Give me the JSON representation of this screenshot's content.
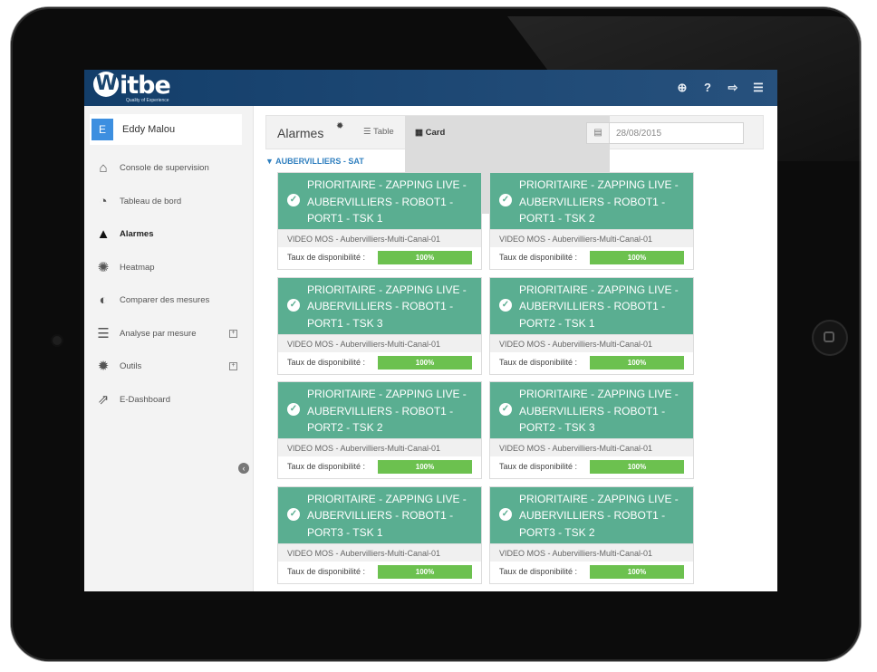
{
  "app": {
    "logo_text": "itbe",
    "logo_mark": "W",
    "logo_tagline": "Quality of Experience"
  },
  "header_icons": [
    {
      "name": "globe-icon",
      "glyph": "⊕"
    },
    {
      "name": "help-icon",
      "glyph": "?"
    },
    {
      "name": "logout-icon",
      "glyph": "⇨"
    },
    {
      "name": "menu-icon",
      "glyph": "☰"
    }
  ],
  "user": {
    "initial": "E",
    "name": "Eddy Malou"
  },
  "sidebar": {
    "items": [
      {
        "label": "Console de supervision",
        "icon": "home-icon",
        "glyph": "⌂",
        "active": false,
        "expandable": false
      },
      {
        "label": "Tableau de bord",
        "icon": "dashboard-icon",
        "glyph": "◔",
        "active": false,
        "expandable": false
      },
      {
        "label": "Alarmes",
        "icon": "warning-icon",
        "glyph": "▲",
        "active": true,
        "expandable": false
      },
      {
        "label": "Heatmap",
        "icon": "spinner-icon",
        "glyph": "✺",
        "active": false,
        "expandable": false
      },
      {
        "label": "Comparer des mesures",
        "icon": "contrast-icon",
        "glyph": "◐",
        "active": false,
        "expandable": false
      },
      {
        "label": "Analyse par mesure",
        "icon": "list-icon",
        "glyph": "☰",
        "active": false,
        "expandable": true
      },
      {
        "label": "Outils",
        "icon": "gear-icon",
        "glyph": "✹",
        "active": false,
        "expandable": true
      },
      {
        "label": "E-Dashboard",
        "icon": "external-link-icon",
        "glyph": "⇗",
        "active": false,
        "expandable": false
      }
    ]
  },
  "toolbar": {
    "title": "Alarmes",
    "table_label": "Table",
    "card_label": "Card",
    "date_value": "28/08/2015"
  },
  "group": {
    "title": "▼ AUBERVILLIERS - SAT"
  },
  "cards": [
    {
      "title": "PRIORITAIRE - ZAPPING LIVE - AUBERVILLIERS - ROBOT1 - PORT1 - TSK 1",
      "subtitle": "VIDEO MOS - Aubervilliers-Multi-Canal-01",
      "avail_label": "Taux de disponibilité :",
      "avail_value": "100%",
      "avail_fraction": 1.0
    },
    {
      "title": "PRIORITAIRE - ZAPPING LIVE - AUBERVILLIERS - ROBOT1 - PORT1 - TSK 2",
      "subtitle": "VIDEO MOS - Aubervilliers-Multi-Canal-01",
      "avail_label": "Taux de disponibilité :",
      "avail_value": "100%",
      "avail_fraction": 1.0
    },
    {
      "title": "PRIORITAIRE - ZAPPING LIVE - AUBERVILLIERS - ROBOT1 - PORT1 - TSK 3",
      "subtitle": "VIDEO MOS - Aubervilliers-Multi-Canal-01",
      "avail_label": "Taux de disponibilité :",
      "avail_value": "100%",
      "avail_fraction": 1.0
    },
    {
      "title": "PRIORITAIRE - ZAPPING LIVE - AUBERVILLIERS - ROBOT1 - PORT2 - TSK 1",
      "subtitle": "VIDEO MOS - Aubervilliers-Multi-Canal-01",
      "avail_label": "Taux de disponibilité :",
      "avail_value": "100%",
      "avail_fraction": 1.0
    },
    {
      "title": "PRIORITAIRE - ZAPPING LIVE - AUBERVILLIERS - ROBOT1 - PORT2 - TSK 2",
      "subtitle": "VIDEO MOS - Aubervilliers-Multi-Canal-01",
      "avail_label": "Taux de disponibilité :",
      "avail_value": "100%",
      "avail_fraction": 1.0
    },
    {
      "title": "PRIORITAIRE - ZAPPING LIVE - AUBERVILLIERS - ROBOT1 - PORT2 - TSK 3",
      "subtitle": "VIDEO MOS - Aubervilliers-Multi-Canal-01",
      "avail_label": "Taux de disponibilité :",
      "avail_value": "100%",
      "avail_fraction": 1.0
    },
    {
      "title": "PRIORITAIRE - ZAPPING LIVE - AUBERVILLIERS - ROBOT1 - PORT3 - TSK 1",
      "subtitle": "VIDEO MOS - Aubervilliers-Multi-Canal-01",
      "avail_label": "Taux de disponibilité :",
      "avail_value": "100%",
      "avail_fraction": 1.0
    },
    {
      "title": "PRIORITAIRE - ZAPPING LIVE - AUBERVILLIERS - ROBOT1 - PORT3 - TSK 2",
      "subtitle": "VIDEO MOS - Aubervilliers-Multi-Canal-01",
      "avail_label": "Taux de disponibilité :",
      "avail_value": "100%",
      "avail_fraction": 1.0
    }
  ],
  "colors": {
    "header_bg": "#1a466f",
    "card_header": "#5aae91",
    "availability_bar": "#6cc14f",
    "group_title": "#2f7fbf",
    "avatar": "#3d8fe0"
  }
}
